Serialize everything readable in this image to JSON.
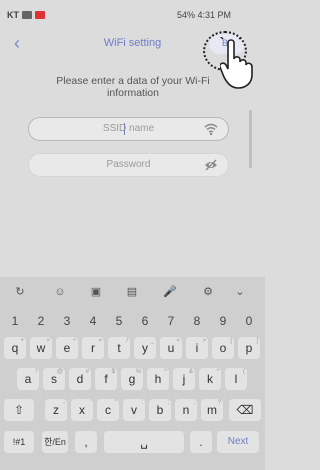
{
  "status_bar": {
    "carrier": "KT",
    "right": "54% 4:31 PM"
  },
  "app_bar": {
    "title": "WiFi setting",
    "button_label": "Ba"
  },
  "instruction": "Please enter a data of your Wi-Fi information",
  "ssid": {
    "placeholder": "SSID name",
    "icon": "wifi-icon"
  },
  "password": {
    "placeholder": "Password",
    "icon": "eye-icon"
  },
  "keyboard": {
    "numbers": [
      "1",
      "2",
      "3",
      "4",
      "5",
      "6",
      "7",
      "8",
      "9",
      "0"
    ],
    "row1": [
      "q",
      "w",
      "e",
      "r",
      "t",
      "y",
      "u",
      "i",
      "o",
      "p"
    ],
    "row1_hints": [
      "+",
      "×",
      "÷",
      "=",
      "/",
      "_",
      "<",
      ">",
      "[",
      "]"
    ],
    "row2": [
      "a",
      "s",
      "d",
      "f",
      "g",
      "h",
      "j",
      "k",
      "l"
    ],
    "row2_hints": [
      "!",
      "@",
      "#",
      "$",
      "%",
      "^",
      "&",
      "*",
      "("
    ],
    "row3": [
      "z",
      "x",
      "c",
      "v",
      "b",
      "n",
      "m"
    ],
    "row3_hints": [
      "-",
      "'",
      "\"",
      ":",
      ";",
      ",",
      "?"
    ],
    "special": "!#1",
    "lang_key": "한/En",
    "comma": ",",
    "period": ".",
    "next": "Next"
  }
}
